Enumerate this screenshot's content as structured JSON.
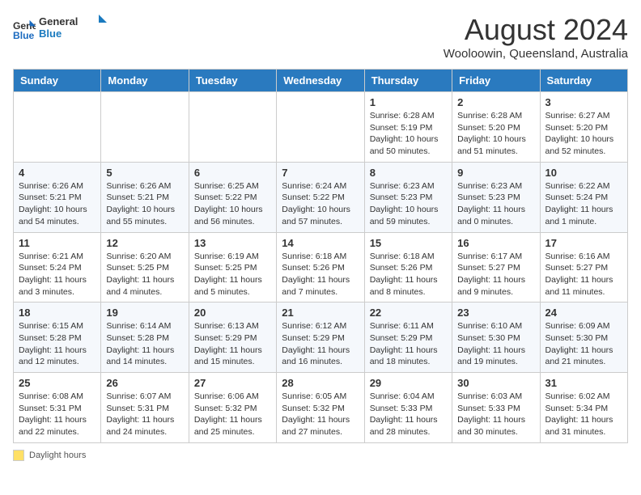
{
  "header": {
    "logo_general": "General",
    "logo_blue": "Blue",
    "month_year": "August 2024",
    "location": "Wooloowin, Queensland, Australia"
  },
  "days_of_week": [
    "Sunday",
    "Monday",
    "Tuesday",
    "Wednesday",
    "Thursday",
    "Friday",
    "Saturday"
  ],
  "weeks": [
    [
      {
        "day": "",
        "info": ""
      },
      {
        "day": "",
        "info": ""
      },
      {
        "day": "",
        "info": ""
      },
      {
        "day": "",
        "info": ""
      },
      {
        "day": "1",
        "info": "Sunrise: 6:28 AM\nSunset: 5:19 PM\nDaylight: 10 hours and 50 minutes."
      },
      {
        "day": "2",
        "info": "Sunrise: 6:28 AM\nSunset: 5:20 PM\nDaylight: 10 hours and 51 minutes."
      },
      {
        "day": "3",
        "info": "Sunrise: 6:27 AM\nSunset: 5:20 PM\nDaylight: 10 hours and 52 minutes."
      }
    ],
    [
      {
        "day": "4",
        "info": "Sunrise: 6:26 AM\nSunset: 5:21 PM\nDaylight: 10 hours and 54 minutes."
      },
      {
        "day": "5",
        "info": "Sunrise: 6:26 AM\nSunset: 5:21 PM\nDaylight: 10 hours and 55 minutes."
      },
      {
        "day": "6",
        "info": "Sunrise: 6:25 AM\nSunset: 5:22 PM\nDaylight: 10 hours and 56 minutes."
      },
      {
        "day": "7",
        "info": "Sunrise: 6:24 AM\nSunset: 5:22 PM\nDaylight: 10 hours and 57 minutes."
      },
      {
        "day": "8",
        "info": "Sunrise: 6:23 AM\nSunset: 5:23 PM\nDaylight: 10 hours and 59 minutes."
      },
      {
        "day": "9",
        "info": "Sunrise: 6:23 AM\nSunset: 5:23 PM\nDaylight: 11 hours and 0 minutes."
      },
      {
        "day": "10",
        "info": "Sunrise: 6:22 AM\nSunset: 5:24 PM\nDaylight: 11 hours and 1 minute."
      }
    ],
    [
      {
        "day": "11",
        "info": "Sunrise: 6:21 AM\nSunset: 5:24 PM\nDaylight: 11 hours and 3 minutes."
      },
      {
        "day": "12",
        "info": "Sunrise: 6:20 AM\nSunset: 5:25 PM\nDaylight: 11 hours and 4 minutes."
      },
      {
        "day": "13",
        "info": "Sunrise: 6:19 AM\nSunset: 5:25 PM\nDaylight: 11 hours and 5 minutes."
      },
      {
        "day": "14",
        "info": "Sunrise: 6:18 AM\nSunset: 5:26 PM\nDaylight: 11 hours and 7 minutes."
      },
      {
        "day": "15",
        "info": "Sunrise: 6:18 AM\nSunset: 5:26 PM\nDaylight: 11 hours and 8 minutes."
      },
      {
        "day": "16",
        "info": "Sunrise: 6:17 AM\nSunset: 5:27 PM\nDaylight: 11 hours and 9 minutes."
      },
      {
        "day": "17",
        "info": "Sunrise: 6:16 AM\nSunset: 5:27 PM\nDaylight: 11 hours and 11 minutes."
      }
    ],
    [
      {
        "day": "18",
        "info": "Sunrise: 6:15 AM\nSunset: 5:28 PM\nDaylight: 11 hours and 12 minutes."
      },
      {
        "day": "19",
        "info": "Sunrise: 6:14 AM\nSunset: 5:28 PM\nDaylight: 11 hours and 14 minutes."
      },
      {
        "day": "20",
        "info": "Sunrise: 6:13 AM\nSunset: 5:29 PM\nDaylight: 11 hours and 15 minutes."
      },
      {
        "day": "21",
        "info": "Sunrise: 6:12 AM\nSunset: 5:29 PM\nDaylight: 11 hours and 16 minutes."
      },
      {
        "day": "22",
        "info": "Sunrise: 6:11 AM\nSunset: 5:29 PM\nDaylight: 11 hours and 18 minutes."
      },
      {
        "day": "23",
        "info": "Sunrise: 6:10 AM\nSunset: 5:30 PM\nDaylight: 11 hours and 19 minutes."
      },
      {
        "day": "24",
        "info": "Sunrise: 6:09 AM\nSunset: 5:30 PM\nDaylight: 11 hours and 21 minutes."
      }
    ],
    [
      {
        "day": "25",
        "info": "Sunrise: 6:08 AM\nSunset: 5:31 PM\nDaylight: 11 hours and 22 minutes."
      },
      {
        "day": "26",
        "info": "Sunrise: 6:07 AM\nSunset: 5:31 PM\nDaylight: 11 hours and 24 minutes."
      },
      {
        "day": "27",
        "info": "Sunrise: 6:06 AM\nSunset: 5:32 PM\nDaylight: 11 hours and 25 minutes."
      },
      {
        "day": "28",
        "info": "Sunrise: 6:05 AM\nSunset: 5:32 PM\nDaylight: 11 hours and 27 minutes."
      },
      {
        "day": "29",
        "info": "Sunrise: 6:04 AM\nSunset: 5:33 PM\nDaylight: 11 hours and 28 minutes."
      },
      {
        "day": "30",
        "info": "Sunrise: 6:03 AM\nSunset: 5:33 PM\nDaylight: 11 hours and 30 minutes."
      },
      {
        "day": "31",
        "info": "Sunrise: 6:02 AM\nSunset: 5:34 PM\nDaylight: 11 hours and 31 minutes."
      }
    ]
  ],
  "footer_note": "Daylight hours"
}
